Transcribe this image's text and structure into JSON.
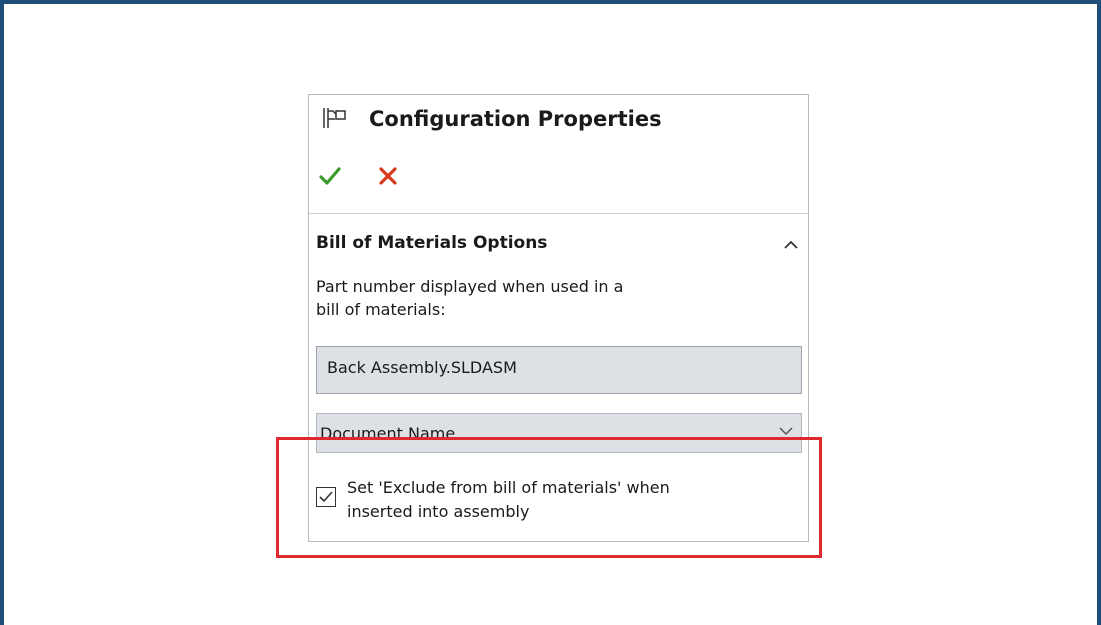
{
  "panel": {
    "title": "Configuration Properties",
    "header_icon": "configuration-icon",
    "actions": {
      "ok_icon": "checkmark-icon",
      "ok_color": "#3a9a2a",
      "cancel_icon": "x-icon",
      "cancel_color": "#d83b1f"
    }
  },
  "bom_section": {
    "title": "Bill of Materials Options",
    "collapse_icon": "chevron-up-icon",
    "description_line1": "Part number displayed when used in a",
    "description_line2": "bill of materials:",
    "part_number_value": "Back Assembly.SLDASM",
    "part_number_source_selected": "Document Name",
    "exclude_checkbox": {
      "checked": true,
      "label_line1": "Set 'Exclude from bill of materials' when",
      "label_line2": "inserted into assembly"
    }
  },
  "highlight_color": "#e0282f",
  "frame_color": "#1f4e79"
}
